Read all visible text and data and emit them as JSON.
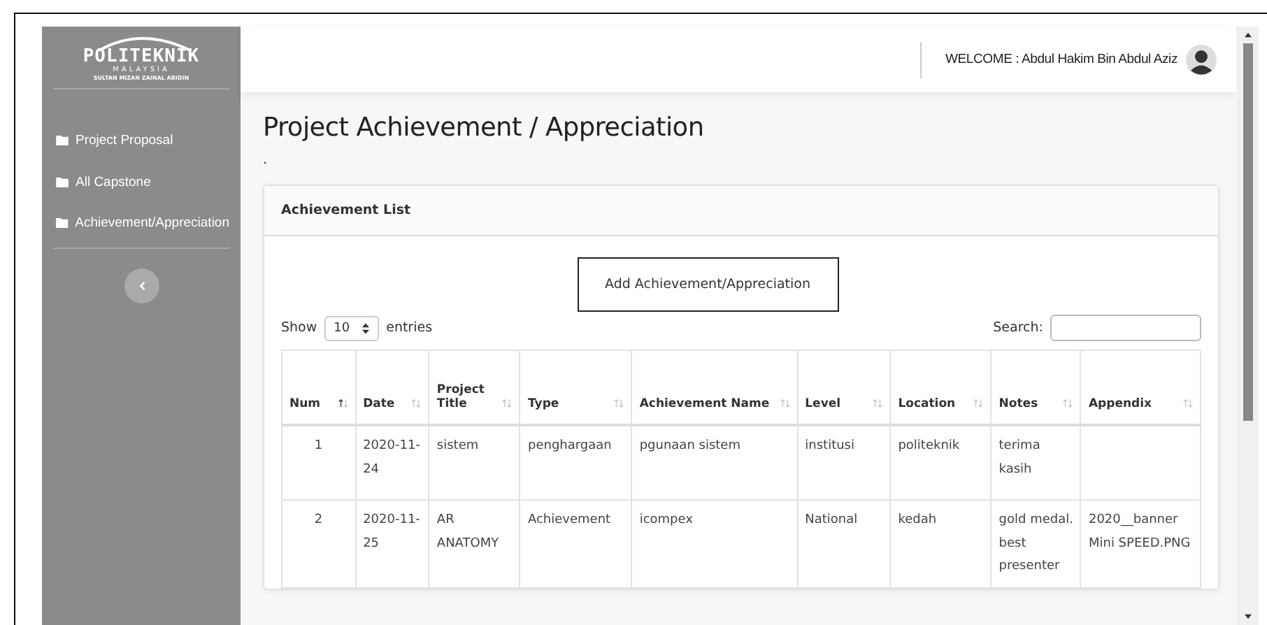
{
  "logo": {
    "name": "POLITEKNIK",
    "country": "MALAYSIA",
    "campus": "SULTAN MIZAN ZAINAL ABIDIN"
  },
  "sidebar": {
    "items": [
      {
        "label": "Project Proposal"
      },
      {
        "label": "All Capstone"
      },
      {
        "label": "Achievement/Appreciation"
      }
    ]
  },
  "header": {
    "welcome": "WELCOME : Abdul Hakim Bin Abdul Aziz"
  },
  "page": {
    "title": "Project Achievement / Appreciation",
    "subtitle": "."
  },
  "card": {
    "title": "Achievement List",
    "add_button": "Add Achievement/Appreciation",
    "length": {
      "show": "Show",
      "value": "10",
      "entries": "entries"
    },
    "search": {
      "label": "Search:"
    },
    "table": {
      "columns": [
        {
          "label": "Num",
          "sorted": true
        },
        {
          "label": "Date",
          "sorted": false
        },
        {
          "label": "Project Title",
          "sorted": false
        },
        {
          "label": "Type",
          "sorted": false
        },
        {
          "label": "Achievement Name",
          "sorted": false
        },
        {
          "label": "Level",
          "sorted": false
        },
        {
          "label": "Location",
          "sorted": false
        },
        {
          "label": "Notes",
          "sorted": false
        },
        {
          "label": "Appendix",
          "sorted": false
        }
      ],
      "rows": [
        [
          "1",
          "2020-11-24",
          "sistem",
          "penghargaan",
          "pgunaan sistem",
          "institusi",
          "politeknik",
          "terima kasih",
          ""
        ],
        [
          "2",
          "2020-11-25",
          "AR ANATOMY",
          "Achievement",
          "icompex",
          "National",
          "kedah",
          "gold medal. best presenter",
          "2020__banner Mini SPEED.PNG"
        ]
      ]
    }
  }
}
